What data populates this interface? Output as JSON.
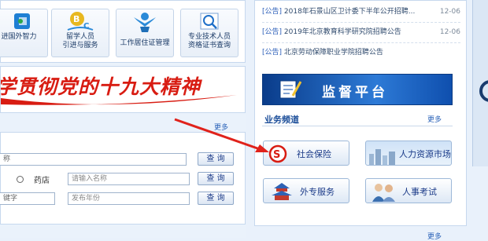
{
  "service_tiles": [
    {
      "label_lines": [
        "进国外智力"
      ]
    },
    {
      "label_lines": [
        "留学人员",
        "引进与服务"
      ]
    },
    {
      "label_lines": [
        "工作居住证管理"
      ]
    },
    {
      "label_lines": [
        "专业技术人员",
        "资格证书查询"
      ]
    }
  ],
  "banner": {
    "text": "学贯彻党的十九大精神"
  },
  "search": {
    "more": "更多",
    "row1": {
      "value": "称",
      "button": "查 询"
    },
    "row2": {
      "radio_label": "药店",
      "placeholder": "请输入名称",
      "button": "查 询"
    },
    "row3": {
      "value": "键字",
      "placeholder": "发布年份",
      "button": "查 询"
    }
  },
  "news": [
    {
      "tag": "[公告]",
      "title": "2018年石景山区卫计委下半年公开招聘...",
      "date": "12-06"
    },
    {
      "tag": "[公告]",
      "title": "2019年北京教育科学研究院招聘公告",
      "date": "12-06"
    },
    {
      "tag": "[公告]",
      "title": "北京劳动保障职业学院招聘公告",
      "date": "12-06"
    }
  ],
  "supervise": {
    "title": "监督平台"
  },
  "channels": {
    "title": "业务频道",
    "more": "更多",
    "items": [
      "社会保险",
      "人力资源市场",
      "外专服务",
      "人事考试"
    ]
  },
  "footer": {
    "more": "更多"
  },
  "colors": {
    "banner_red": "#d81c12",
    "link_blue": "#2a5db8",
    "arrow_red": "#e0221b"
  }
}
